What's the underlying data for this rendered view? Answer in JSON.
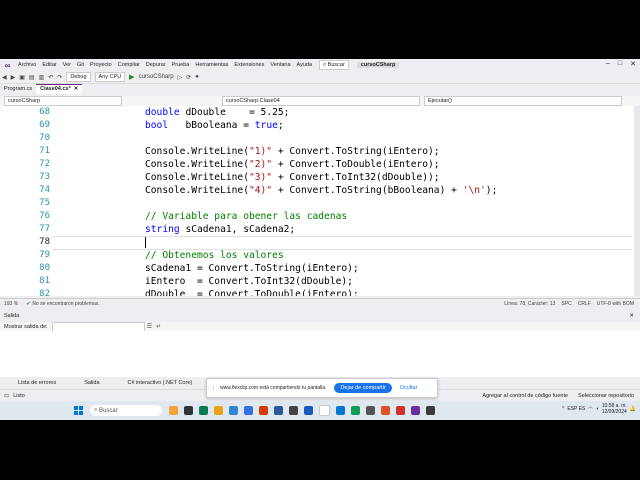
{
  "menu": [
    "Archivo",
    "Editar",
    "Ver",
    "Git",
    "Proyecto",
    "Compilar",
    "Depurar",
    "Prueba",
    "Herramientas",
    "Extensiones",
    "Ventana",
    "Ayuda"
  ],
  "search_label": "Buscar",
  "project_name": "cursoCSharp",
  "toolbar": {
    "config": "Debug",
    "platform": "Any CPU",
    "run_target": "cursoCSharp"
  },
  "tabs": [
    {
      "label": "Program.cs",
      "active": false
    },
    {
      "label": "Clase04.cs*",
      "active": true
    }
  ],
  "subbar": {
    "project": "cursoCSharp",
    "class": "cursoCSharp.Clase04",
    "member": "Ejecutar()"
  },
  "code_lines": [
    {
      "n": "68",
      "parts": [
        {
          "t": "double ",
          "c": "kw"
        },
        {
          "t": "dDouble    = 5.25;",
          "c": ""
        }
      ]
    },
    {
      "n": "69",
      "parts": [
        {
          "t": "bool ",
          "c": "kw"
        },
        {
          "t": "  bBooleana = ",
          "c": ""
        },
        {
          "t": "true",
          "c": "kw"
        },
        {
          "t": ";",
          "c": ""
        }
      ]
    },
    {
      "n": "70",
      "parts": []
    },
    {
      "n": "71",
      "parts": [
        {
          "t": "Console.WriteLine(",
          "c": ""
        },
        {
          "t": "\"1)\"",
          "c": "str"
        },
        {
          "t": " + Convert.ToString(iEntero);",
          "c": ""
        }
      ]
    },
    {
      "n": "72",
      "parts": [
        {
          "t": "Console.WriteLine(",
          "c": ""
        },
        {
          "t": "\"2)\"",
          "c": "str"
        },
        {
          "t": " + Convert.ToDouble(iEntero);",
          "c": ""
        }
      ]
    },
    {
      "n": "73",
      "parts": [
        {
          "t": "Console.WriteLine(",
          "c": ""
        },
        {
          "t": "\"3)\"",
          "c": "str"
        },
        {
          "t": " + Convert.ToInt32(dDouble));",
          "c": ""
        }
      ]
    },
    {
      "n": "74",
      "parts": [
        {
          "t": "Console.WriteLine(",
          "c": ""
        },
        {
          "t": "\"4)\"",
          "c": "str"
        },
        {
          "t": " + Convert.ToString(bBooleana) + ",
          "c": ""
        },
        {
          "t": "'\\n'",
          "c": "str"
        },
        {
          "t": ");",
          "c": ""
        }
      ]
    },
    {
      "n": "75",
      "parts": []
    },
    {
      "n": "76",
      "parts": [
        {
          "t": "// Variable para obener las cadenas",
          "c": "cmt"
        }
      ]
    },
    {
      "n": "77",
      "parts": [
        {
          "t": "string ",
          "c": "kw"
        },
        {
          "t": "sCadena1, sCadena2;",
          "c": ""
        }
      ]
    },
    {
      "n": "78",
      "parts": [],
      "current": true
    },
    {
      "n": "79",
      "parts": [
        {
          "t": "// Obtenemos los valores",
          "c": "cmt"
        }
      ]
    },
    {
      "n": "80",
      "parts": [
        {
          "t": "sCadena1 = Convert.ToString(iEntero);",
          "c": ""
        }
      ]
    },
    {
      "n": "81",
      "parts": [
        {
          "t": "iEntero  = Convert.ToInt32(dDouble);",
          "c": ""
        }
      ]
    },
    {
      "n": "82",
      "parts": [
        {
          "t": "dDouble  = Convert.ToDouble(iEntero);",
          "c": ""
        }
      ]
    }
  ],
  "editor_status": {
    "zoom": "193 %",
    "problems": "No se encontraron problemas.",
    "position": "Línea: 78, Carácter: 13",
    "spc": "SPC",
    "crlf": "CRLF",
    "encoding": "UTF-8 with BOM"
  },
  "output_panel": {
    "title": "Salida",
    "show_output": "Mostrar salida de:"
  },
  "bottom_tabs": [
    "Lista de errores",
    "Salida",
    "C# interactivo (.NET Core)"
  ],
  "status": {
    "ready": "Listo",
    "add_source": "Agregar al control de código fuente",
    "select_repo": "Seleccionar repositorio"
  },
  "share_bar": {
    "text": "www.flexclip.com está compartiendo tu pantalla.",
    "stop": "Dejar de compartir",
    "hide": "Ocultar"
  },
  "taskbar": {
    "search": "Buscar",
    "lang": "ESP ES",
    "time": "10:58 a. m.",
    "date": "12/09/2024"
  }
}
